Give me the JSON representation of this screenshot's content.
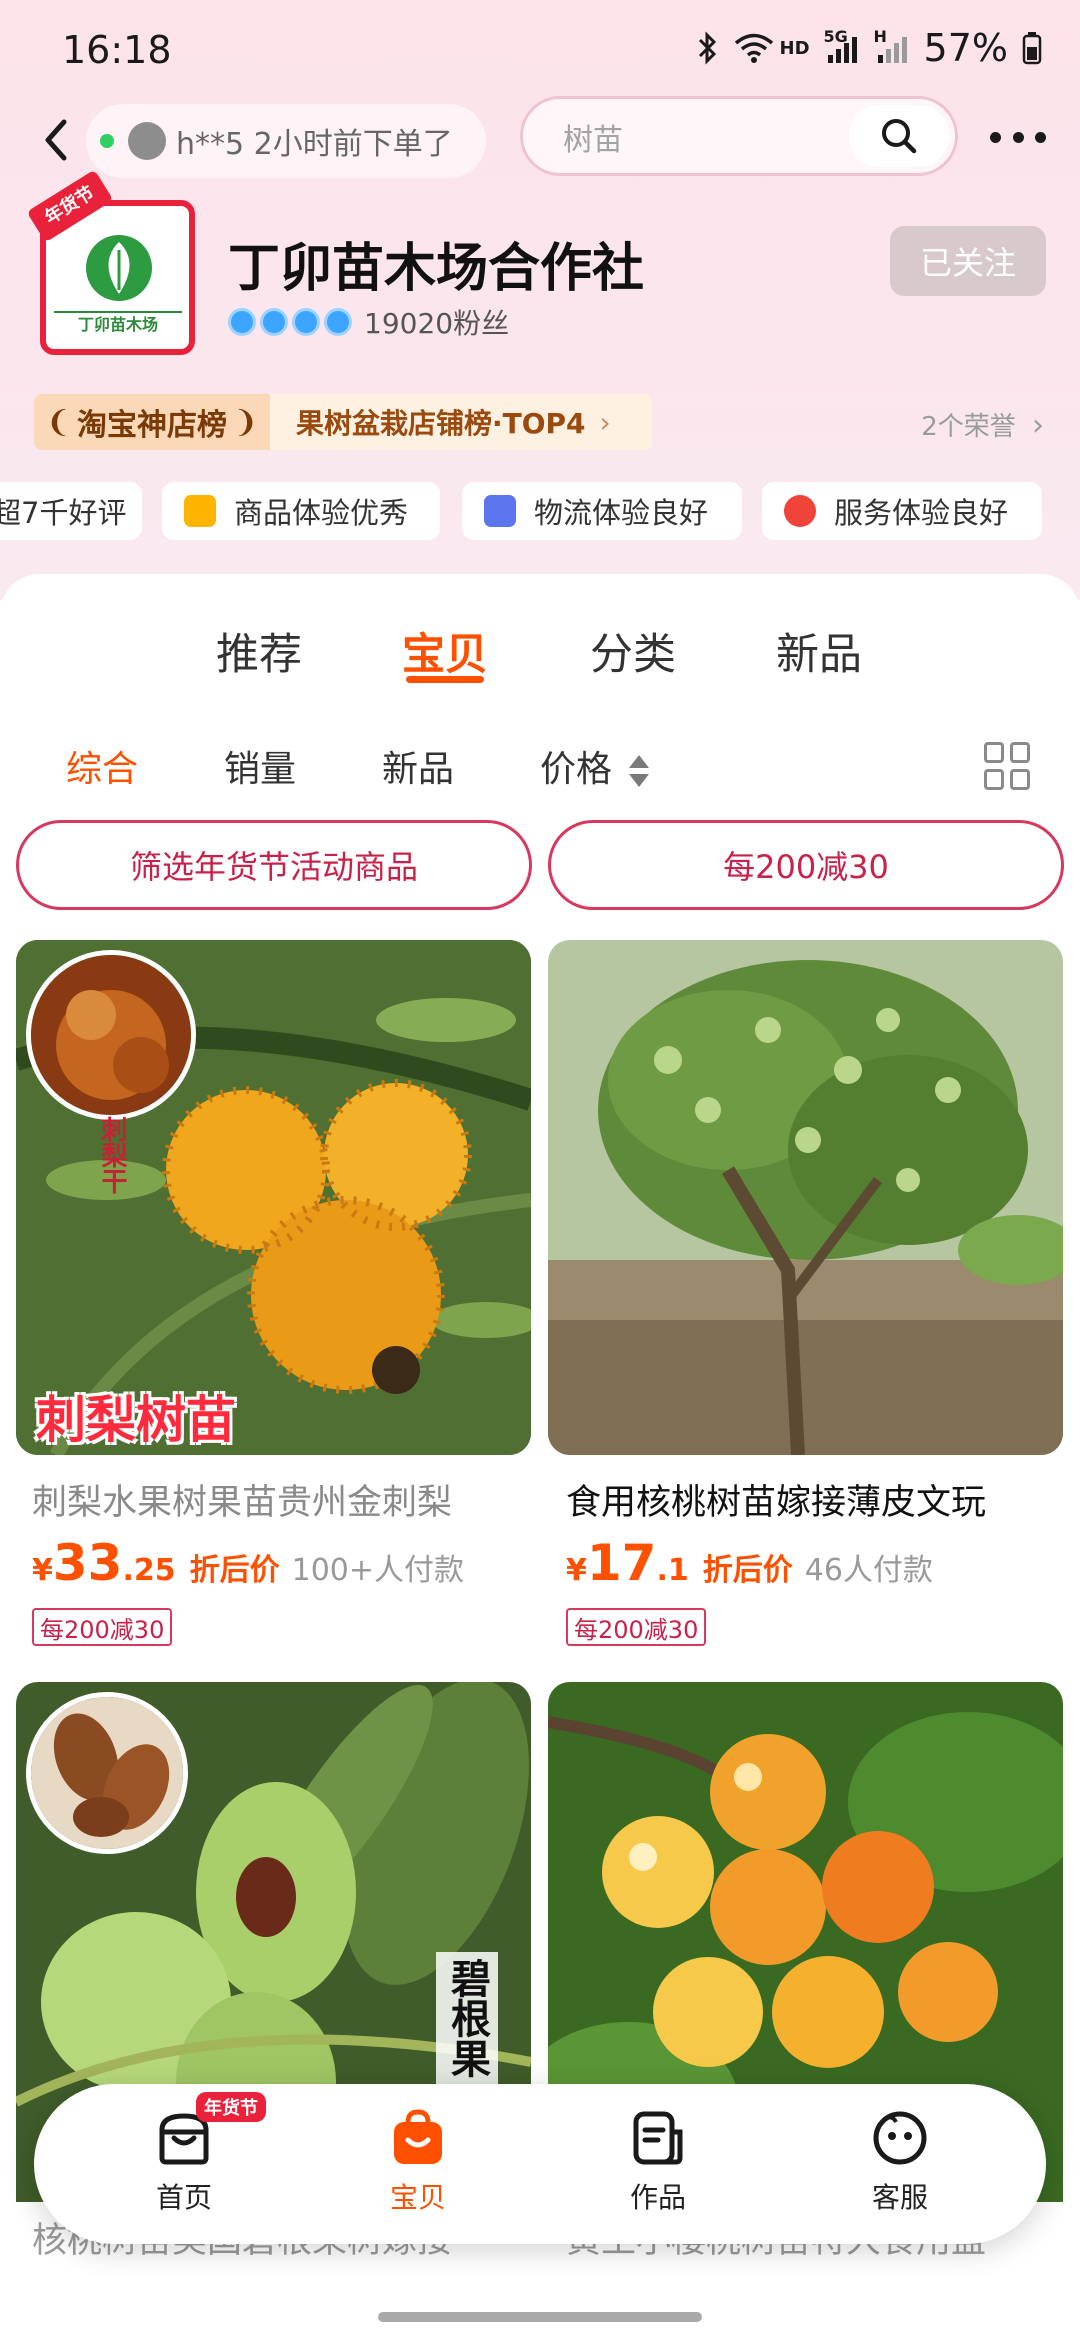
{
  "status_bar": {
    "time": "16:18",
    "network": "HD",
    "signal_5g": "5G",
    "signal_h": "H",
    "battery": "57%"
  },
  "nav": {
    "ticker_text": "h**5 2小时前下单了",
    "search_placeholder": "树苗"
  },
  "shop": {
    "name": "丁卯苗木场合作社",
    "logo_badge": "年货节",
    "logo_strip": "丁卯苗木场",
    "fans": "19020粉丝",
    "follow_label": "已关注"
  },
  "honor": {
    "left_label": "淘宝神店榜",
    "right_label": "果树盆栽店铺榜·TOP4",
    "count_label": "2个荣誉"
  },
  "chips": [
    {
      "label": "超7千好评",
      "icon": "none"
    },
    {
      "label": "商品体验优秀",
      "icon": "bag-icon"
    },
    {
      "label": "物流体验良好",
      "icon": "truck-icon"
    },
    {
      "label": "服务体验良好",
      "icon": "service-icon"
    }
  ],
  "main_tabs": [
    "推荐",
    "宝贝",
    "分类",
    "新品"
  ],
  "active_main_tab": "宝贝",
  "sort": {
    "items": [
      "综合",
      "销量",
      "新品",
      "价格"
    ],
    "active": "综合"
  },
  "filters": {
    "left": "筛选年货节活动商品",
    "right": "每200减30"
  },
  "products": [
    {
      "title": "刺梨水果树果苗贵州金刺梨",
      "price_symbol": "¥",
      "price_int": "33",
      "price_dec": ".25",
      "price_label": "折后价",
      "sold": "100+人付款",
      "promo": "每200减30",
      "image_caption": "刺梨树苗",
      "badge_text": "刺梨干"
    },
    {
      "title": "食用核桃树苗嫁接薄皮文玩",
      "price_symbol": "¥",
      "price_int": "17",
      "price_dec": ".1",
      "price_label": "折后价",
      "sold": "46人付款",
      "promo": "每200减30"
    },
    {
      "title": "核桃树苗美国碧根果树嫁接",
      "image_caption": "碧根果"
    },
    {
      "title": "黄土小樱桃树苗特大食用盆"
    }
  ],
  "bottom_nav": {
    "items": [
      "首页",
      "宝贝",
      "作品",
      "客服"
    ],
    "active": "宝贝",
    "home_badge": "年货节"
  },
  "colors": {
    "accent": "#ff5000",
    "promo_red": "#c8224a",
    "header_bg": "#fde3ea"
  }
}
